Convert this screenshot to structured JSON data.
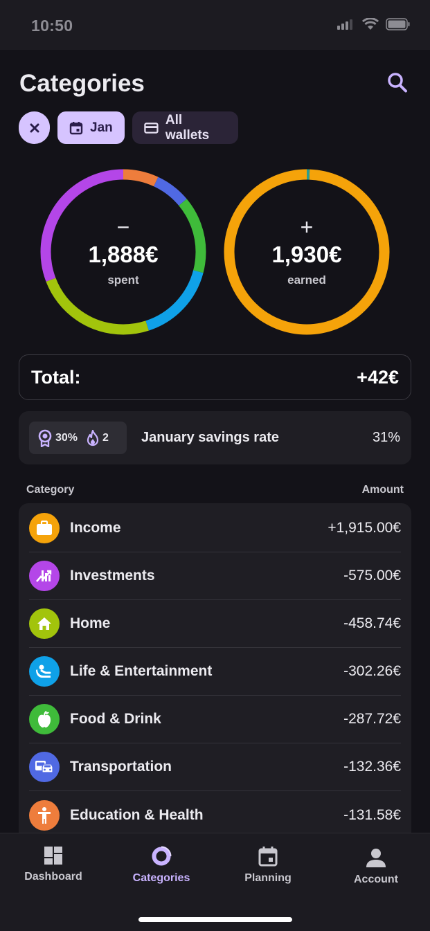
{
  "status_bar": {
    "time": "10:50"
  },
  "header": {
    "title": "Categories"
  },
  "filters": {
    "month": "Jan",
    "wallets": "All wallets"
  },
  "summary": {
    "spent": {
      "sign": "−",
      "amount": "1,888€",
      "label": "spent"
    },
    "earned": {
      "sign": "+",
      "amount": "1,930€",
      "label": "earned"
    }
  },
  "total": {
    "label": "Total:",
    "value": "+42€"
  },
  "savings": {
    "badge_percent": "30%",
    "badge_streak": "2",
    "label": "January savings rate",
    "value": "31%"
  },
  "list": {
    "header_category": "Category",
    "header_amount": "Amount",
    "items": [
      {
        "name": "Income",
        "amount": "+1,915.00€",
        "color": "#f5a30a",
        "icon": "briefcase-icon"
      },
      {
        "name": "Investments",
        "amount": "-575.00€",
        "color": "#b446e8",
        "icon": "investments-chart-icon"
      },
      {
        "name": "Home",
        "amount": "-458.74€",
        "color": "#a2c40c",
        "icon": "home-icon"
      },
      {
        "name": "Life & Entertainment",
        "amount": "-302.26€",
        "color": "#0fa1e8",
        "icon": "person-relax-icon"
      },
      {
        "name": "Food & Drink",
        "amount": "-287.72€",
        "color": "#3fbb3a",
        "icon": "apple-icon"
      },
      {
        "name": "Transportation",
        "amount": "-132.36€",
        "color": "#5069e3",
        "icon": "vehicles-icon"
      },
      {
        "name": "Education & Health",
        "amount": "-131.58€",
        "color": "#ee7d3c",
        "icon": "person-figure-icon"
      }
    ]
  },
  "nav": {
    "items": [
      {
        "label": "Dashboard",
        "icon": "dashboard-icon"
      },
      {
        "label": "Categories",
        "icon": "donut-icon",
        "active": true
      },
      {
        "label": "Planning",
        "icon": "calendar-icon"
      },
      {
        "label": "Account",
        "icon": "account-icon"
      }
    ]
  },
  "colors": {
    "accent": "#c9b3ff",
    "spent_ring": [
      "#ee7d3c",
      "#5069e3",
      "#3fbb3a",
      "#0fa1e8",
      "#a2c40c",
      "#b446e8"
    ],
    "earned_ring": [
      "#f5a30a",
      "#2a9d8f"
    ]
  }
}
